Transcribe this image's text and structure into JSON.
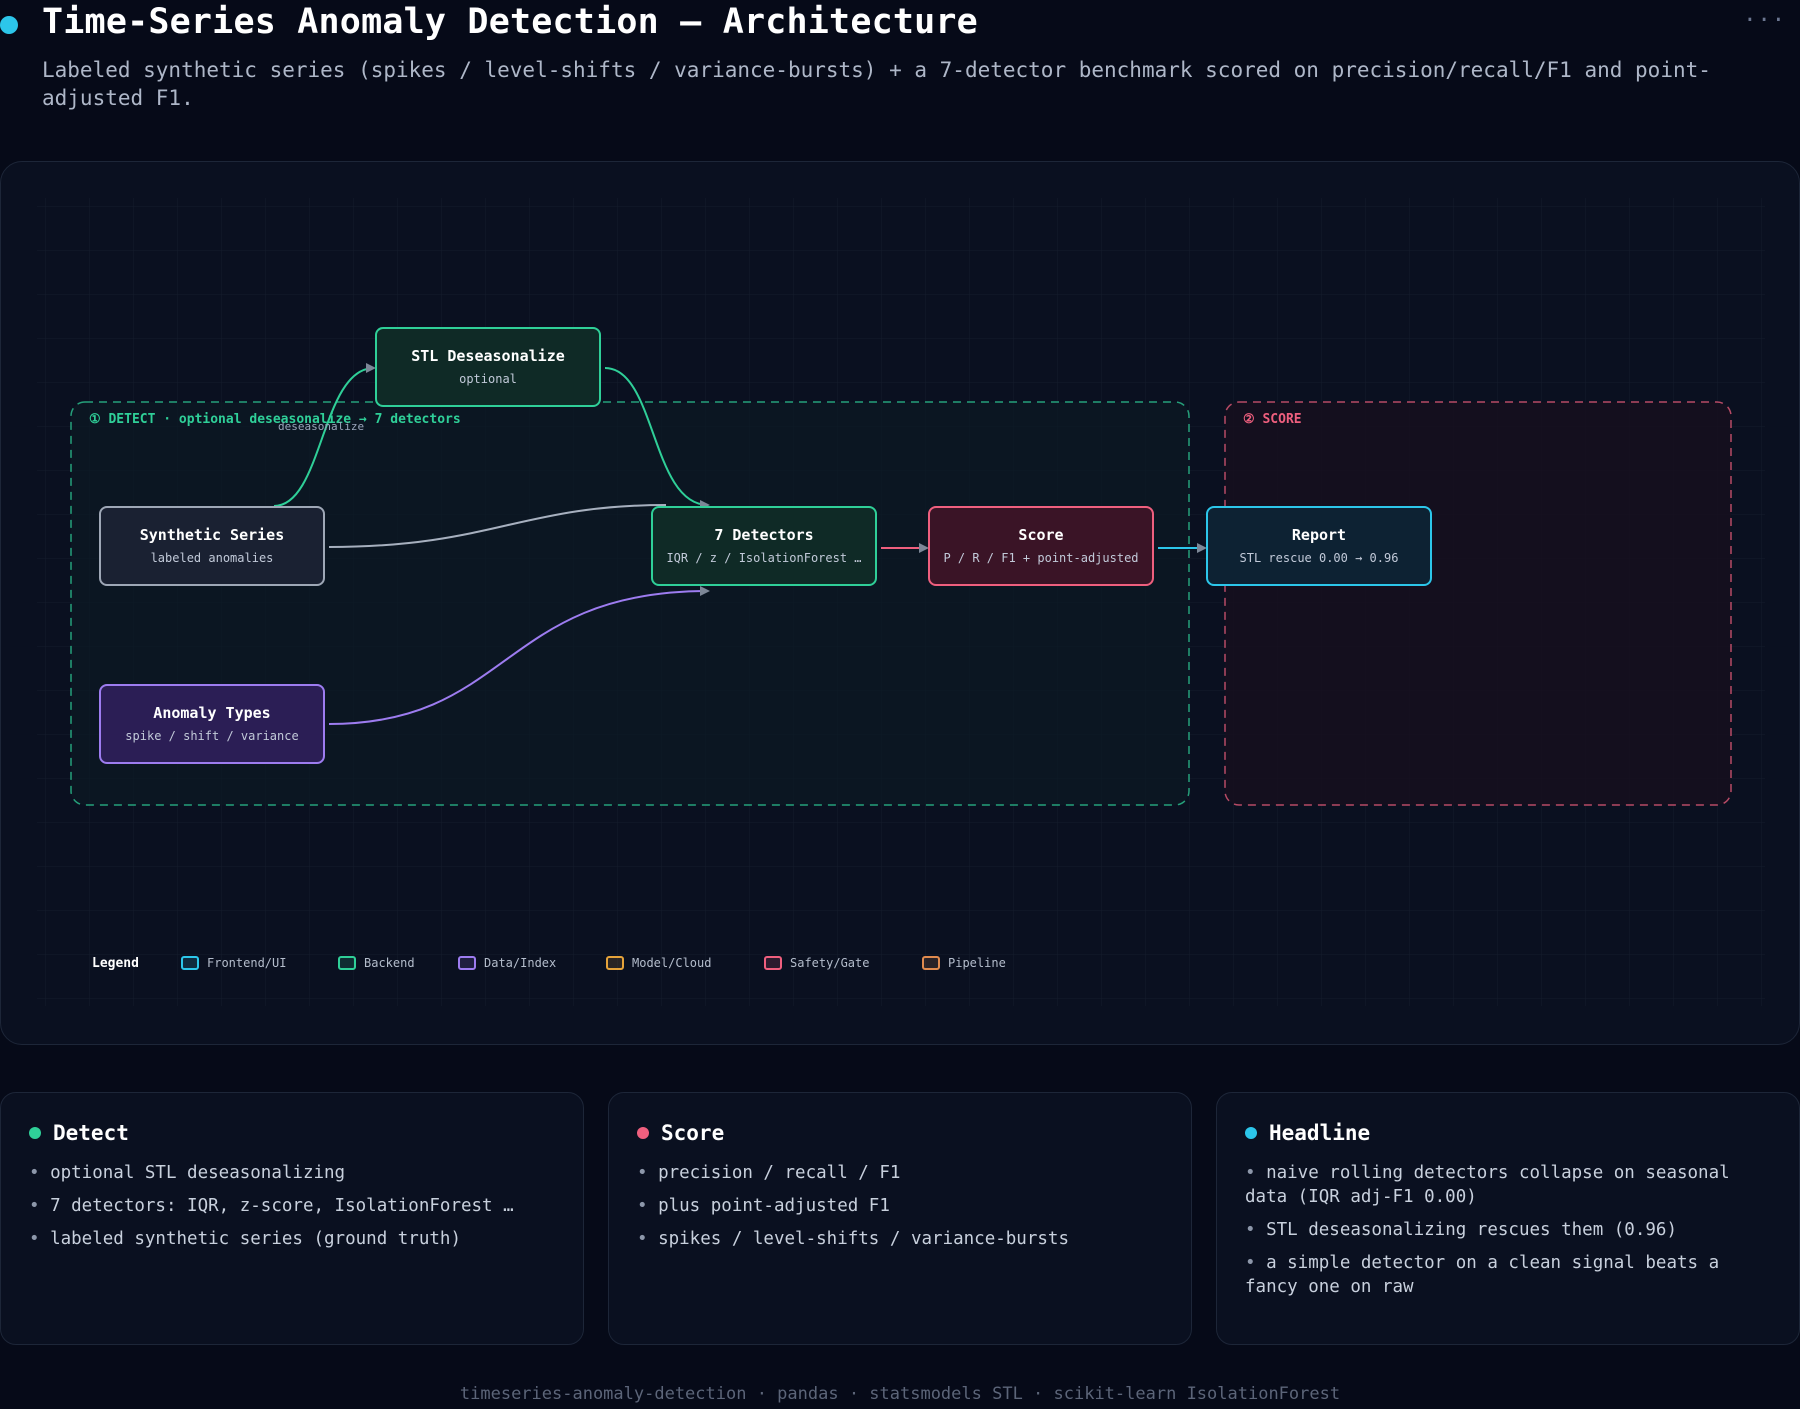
{
  "header": {
    "title": "Time-Series Anomaly Detection — Architecture",
    "subtitle": "Labeled synthetic series (spikes / level-shifts / variance-bursts) + a 7-detector benchmark scored on precision/recall/F1 and point-adjusted F1.",
    "menu_icon": "more-dots-icon"
  },
  "diagram": {
    "groups": {
      "detect": "① DETECT · optional deseasonalize → 7 detectors",
      "score": "② SCORE"
    },
    "nodes": {
      "stl": {
        "title": "STL Deseasonalize",
        "subtitle": "optional"
      },
      "synthetic": {
        "title": "Synthetic Series",
        "subtitle": "labeled anomalies"
      },
      "anomaly": {
        "title": "Anomaly Types",
        "subtitle": "spike / shift / variance"
      },
      "detectors": {
        "title": "7 Detectors",
        "subtitle": "IQR / z / IsolationForest …"
      },
      "score": {
        "title": "Score",
        "subtitle": "P / R / F1 + point-adjusted"
      },
      "report": {
        "title": "Report",
        "subtitle": "STL rescue 0.00 → 0.96"
      }
    },
    "edge_labels": {
      "deseasonalize": "deseasonalize"
    },
    "legend": {
      "title": "Legend",
      "items": [
        {
          "label": "Frontend/UI",
          "color": "#2cc6ea"
        },
        {
          "label": "Backend",
          "color": "#2fcf98"
        },
        {
          "label": "Data/Index",
          "color": "#9d7cf0"
        },
        {
          "label": "Model/Cloud",
          "color": "#e6a33a"
        },
        {
          "label": "Safety/Gate",
          "color": "#ef5f7e"
        },
        {
          "label": "Pipeline",
          "color": "#e08a4e"
        }
      ]
    },
    "colors": {
      "detect": "#2fcf98",
      "score": "#ef5f7e",
      "data": "#9d7cf0",
      "frontend": "#2cc6ea",
      "neutral": "#a7b0bf"
    }
  },
  "cards": {
    "detect": {
      "title": "Detect",
      "color": "#2fcf98",
      "bullets": [
        "optional STL deseasonalizing",
        "7 detectors: IQR, z-score, IsolationForest …",
        "labeled synthetic series (ground truth)"
      ]
    },
    "score": {
      "title": "Score",
      "color": "#ef5f7e",
      "bullets": [
        "precision / recall / F1",
        "plus point-adjusted F1",
        "spikes / level-shifts / variance-bursts"
      ]
    },
    "headline": {
      "title": "Headline",
      "color": "#2cc6ea",
      "bullets": [
        "naive rolling detectors collapse on seasonal data (IQR adj-F1 0.00)",
        "STL deseasonalizing rescues them (0.96)",
        "a simple detector on a clean signal beats a fancy one on raw"
      ]
    }
  },
  "footer": {
    "text": "timeseries-anomaly-detection · pandas · statsmodels STL · scikit-learn IsolationForest"
  }
}
